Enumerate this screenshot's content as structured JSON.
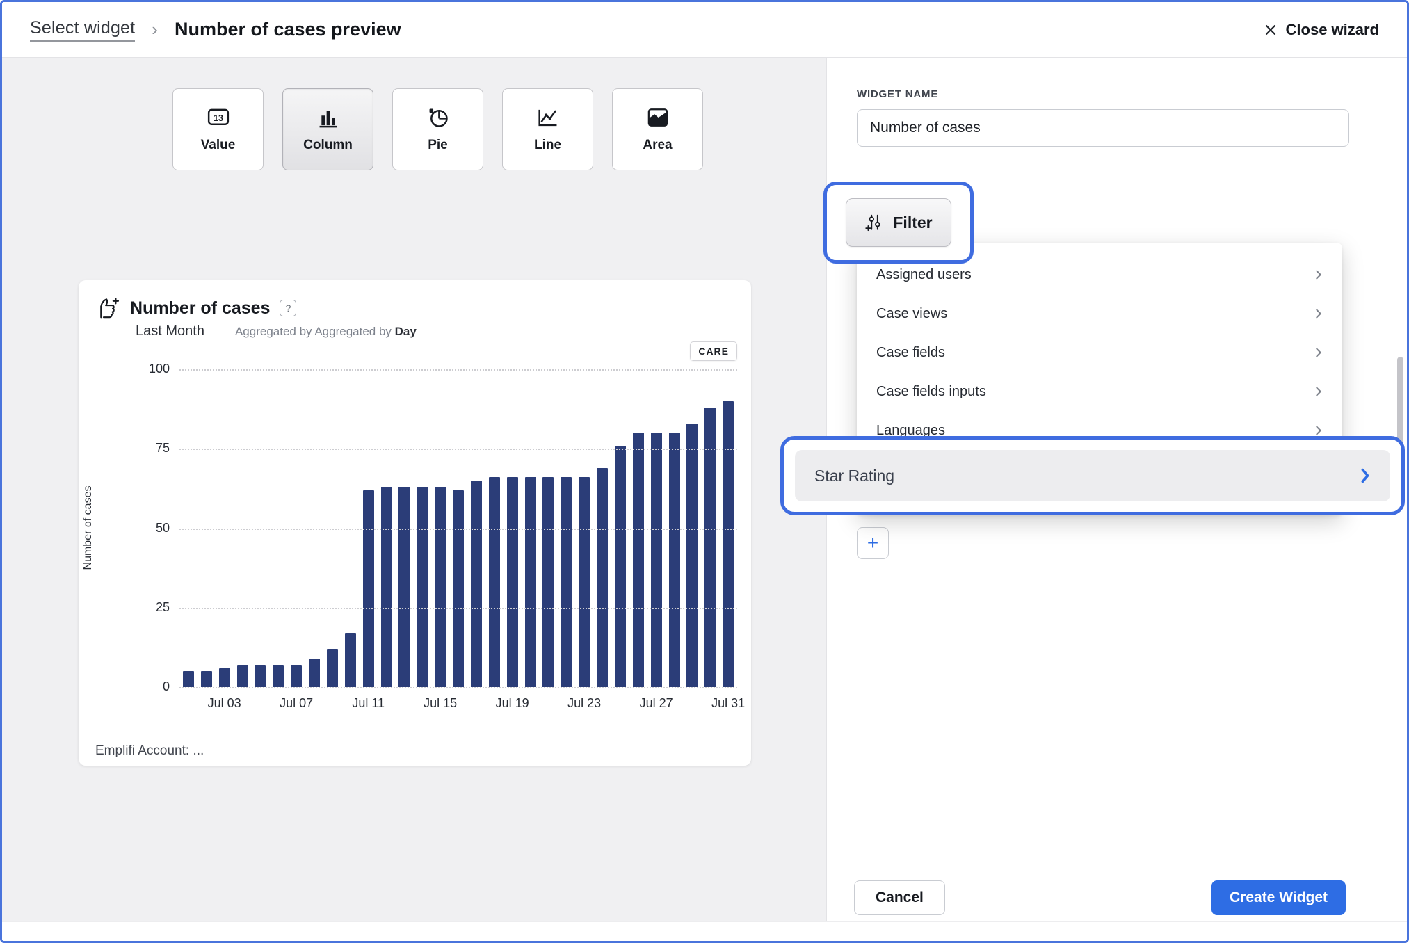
{
  "header": {
    "breadcrumb": "Select widget",
    "separator": "›",
    "title": "Number of cases preview",
    "close_label": "Close wizard"
  },
  "chart_types": [
    {
      "label": "Value",
      "selected": false
    },
    {
      "label": "Column",
      "selected": true
    },
    {
      "label": "Pie",
      "selected": false
    },
    {
      "label": "Line",
      "selected": false
    },
    {
      "label": "Area",
      "selected": false
    }
  ],
  "widget_form": {
    "name_label": "WIDGET NAME",
    "name_value": "Number of cases",
    "filter_label": "Filter",
    "add_filter_label": "+"
  },
  "filter_menu": {
    "items": [
      {
        "label": "Assigned users"
      },
      {
        "label": "Case views"
      },
      {
        "label": "Case fields"
      },
      {
        "label": "Case fields inputs"
      },
      {
        "label": "Languages"
      }
    ],
    "highlighted_item": "Star Rating"
  },
  "footer_actions": {
    "cancel_label": "Cancel",
    "create_label": "Create Widget"
  },
  "preview_card": {
    "title": "Number of cases",
    "help_glyph": "?",
    "period": "Last Month",
    "aggregated_prefix": "Aggregated by",
    "aggregated_value": "Day",
    "badge": "CARE",
    "footer": "Emplifi Account: ..."
  },
  "chart_data": {
    "type": "bar",
    "title": "Number of cases",
    "ylabel": "Number of cases",
    "ylim": [
      0,
      100
    ],
    "yticks": [
      0,
      25,
      50,
      75,
      100
    ],
    "grid": "dotted horizontal",
    "legend": false,
    "bar_color": "#2b3d78",
    "x_tick_labels": [
      "Jul 03",
      "Jul 07",
      "Jul 11",
      "Jul 15",
      "Jul 19",
      "Jul 23",
      "Jul 27",
      "Jul 31"
    ],
    "x_tick_indices": [
      2,
      6,
      10,
      14,
      18,
      22,
      26,
      30
    ],
    "values": [
      5,
      5,
      6,
      7,
      7,
      7,
      7,
      9,
      12,
      17,
      62,
      63,
      63,
      63,
      63,
      62,
      65,
      66,
      66,
      66,
      66,
      66,
      66,
      69,
      76,
      80,
      80,
      80,
      83,
      88,
      90
    ]
  },
  "colors": {
    "accent_blue": "#3f6ce0",
    "primary_button_blue": "#2e6de4",
    "bar_navy": "#2b3d78"
  }
}
